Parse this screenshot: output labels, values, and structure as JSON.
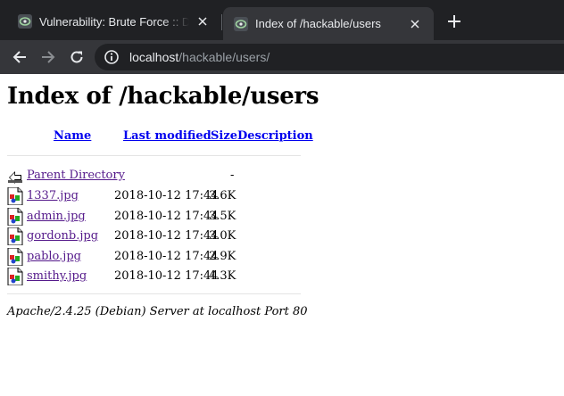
{
  "browser": {
    "tabs": [
      {
        "title": "Vulnerability: Brute Force :: Da",
        "active": false
      },
      {
        "title": "Index of /hackable/users",
        "active": true
      }
    ],
    "url": {
      "host": "localhost",
      "path": "/hackable/users/"
    },
    "icons": [
      "back-arrow-icon",
      "forward-arrow-icon",
      "reload-icon",
      "site-info-icon",
      "close-icon",
      "plus-icon",
      "favicon-icon"
    ]
  },
  "page": {
    "title": "Index of /hackable/users",
    "headers": {
      "name": "Name",
      "last_modified": "Last modified",
      "size": "Size",
      "description": "Description"
    },
    "parent": {
      "name": "Parent Directory",
      "size": "-"
    },
    "files": [
      {
        "name": "1337.jpg",
        "modified": "2018-10-12 17:44",
        "size": "3.6K"
      },
      {
        "name": "admin.jpg",
        "modified": "2018-10-12 17:44",
        "size": "3.5K"
      },
      {
        "name": "gordonb.jpg",
        "modified": "2018-10-12 17:44",
        "size": "3.0K"
      },
      {
        "name": "pablo.jpg",
        "modified": "2018-10-12 17:44",
        "size": "2.9K"
      },
      {
        "name": "smithy.jpg",
        "modified": "2018-10-12 17:44",
        "size": "4.3K"
      }
    ],
    "footer": "Apache/2.4.25 (Debian) Server at localhost Port 80"
  },
  "colors": {
    "tabbar": "#202124",
    "toolbar": "#35363a",
    "link": "#0000ee",
    "visited": "#551a8b"
  }
}
